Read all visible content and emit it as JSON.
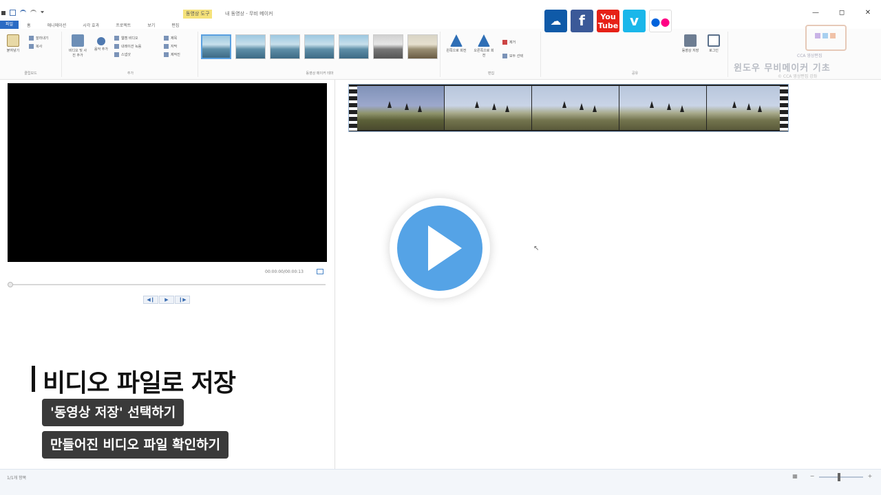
{
  "window": {
    "context_tab": "동영상 도구",
    "title": "내 동영상 - 무비 메이커",
    "controls": [
      "—",
      "◻",
      "✕"
    ]
  },
  "menu_tabs": [
    "파일",
    "홈",
    "애니메이션",
    "시각 효과",
    "프로젝트",
    "보기",
    "편집"
  ],
  "ribbon": {
    "groups": [
      "클립보드",
      "추가",
      "동영상 메이커 테마",
      "편집",
      "공유"
    ],
    "clipboard": {
      "paste": "붙여넣기",
      "cut": "잘라내기",
      "copy": "복사"
    },
    "add": {
      "add_video": "비디오 및 사진 추가",
      "add_music": "음악 추가",
      "webcam": "웹캠 비디오",
      "narration": "내레이션 녹음",
      "snapshot": "스냅샷",
      "title": "제목",
      "caption": "자막",
      "credits": "제작진"
    },
    "edit": {
      "rotate_left": "왼쪽으로 회전",
      "rotate_right": "오른쪽으로 회전",
      "remove": "제거",
      "select_all": "모두 선택"
    },
    "share": {
      "save_movie": "동영상 저장",
      "sign_in": "로그인"
    }
  },
  "watermark": {
    "line1": "CCA 영상편집",
    "line2": "윈도우 무비메이커 기초",
    "line3": "© CCA 영상편집 강좌"
  },
  "preview": {
    "time": "00:00:00/00:00:13"
  },
  "caption": {
    "title": "비디오 파일로 저장",
    "step1": "'동영상 저장' 선택하기",
    "step2": "만들어진 비디오 파일 확인하기"
  },
  "status": {
    "text": "1/1개 항목"
  },
  "colors": {
    "file_tab": "#2a6bc4",
    "play_button": "#55a3e6",
    "onedrive": "#0f5aa8",
    "facebook": "#3b5998",
    "youtube": "#e62117",
    "vimeo": "#1ab7ea",
    "flickr_blue": "#0063dc",
    "flickr_pink": "#ff0084"
  }
}
